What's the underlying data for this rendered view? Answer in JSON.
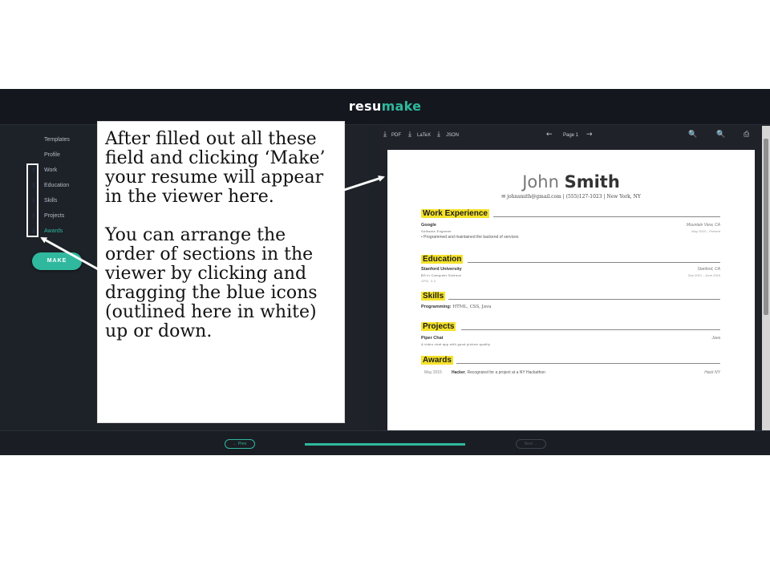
{
  "app": {
    "brand_part1": "resu",
    "brand_part2": "make"
  },
  "sidebar": {
    "items": [
      {
        "label": "Templates"
      },
      {
        "label": "Profile"
      },
      {
        "label": "Work"
      },
      {
        "label": "Education"
      },
      {
        "label": "Skills"
      },
      {
        "label": "Projects"
      },
      {
        "label": "Awards"
      }
    ],
    "make_label": "MAKE"
  },
  "viewer": {
    "pdf_label": "PDF",
    "latex_label": "LaTeX",
    "json_label": "JSON",
    "page_label": "Page 1"
  },
  "resume": {
    "first_name": "John",
    "last_name": "Smith",
    "contact": "johnsmith@gmail.com | (555)127-1023 | New York, NY",
    "sections": {
      "work": "Work Experience",
      "education": "Education",
      "skills": "Skills",
      "projects": "Projects",
      "awards": "Awards"
    },
    "work": {
      "company": "Google",
      "position": "Software Engineer",
      "location": "Mountain View, CA",
      "dates": "May 2015 – Present",
      "highlight": "Programmed and maintained the backend of services"
    },
    "education": {
      "school": "Stanford University",
      "degree": "BS in Computer Science",
      "gpa": "GPA: 3.0",
      "location": "Stanford, CA",
      "dates": "Sep 2012 – June 2016"
    },
    "skills": {
      "label": "Programming:",
      "value": "HTML, CSS, Java"
    },
    "projects": {
      "name": "Piper Chat",
      "desc": "A video chat app with good picture quality",
      "tech": "Java"
    },
    "awards": {
      "date": "May 2015",
      "title": "Hacker",
      "desc": ", Recognized for a project at a NY Hackathon",
      "awarder": "Hack NY"
    }
  },
  "footer": {
    "prev_label": "← Prev",
    "next_label": "Next →",
    "progress": 1.0
  },
  "callout": {
    "paragraph1": "After filled out all these\nfield and clicking ‘Make’\nyour resume will appear\nin the viewer here.",
    "paragraph2": "You can arrange the\norder of sections in the\nviewer by clicking and\ndragging the blue icons\n(outlined here in white)\nup or down."
  },
  "colors": {
    "accent": "#2fb89e",
    "highlight": "#f5e22a",
    "drag_icon": "#3b7de0",
    "background": "#1d2128"
  },
  "icons": [
    "download-icon",
    "arrow-left-icon",
    "arrow-right-icon",
    "zoom-in-icon",
    "zoom-out-icon",
    "print-icon",
    "drag-handle-icon",
    "envelope-icon",
    "phone-icon",
    "location-pin-icon"
  ]
}
